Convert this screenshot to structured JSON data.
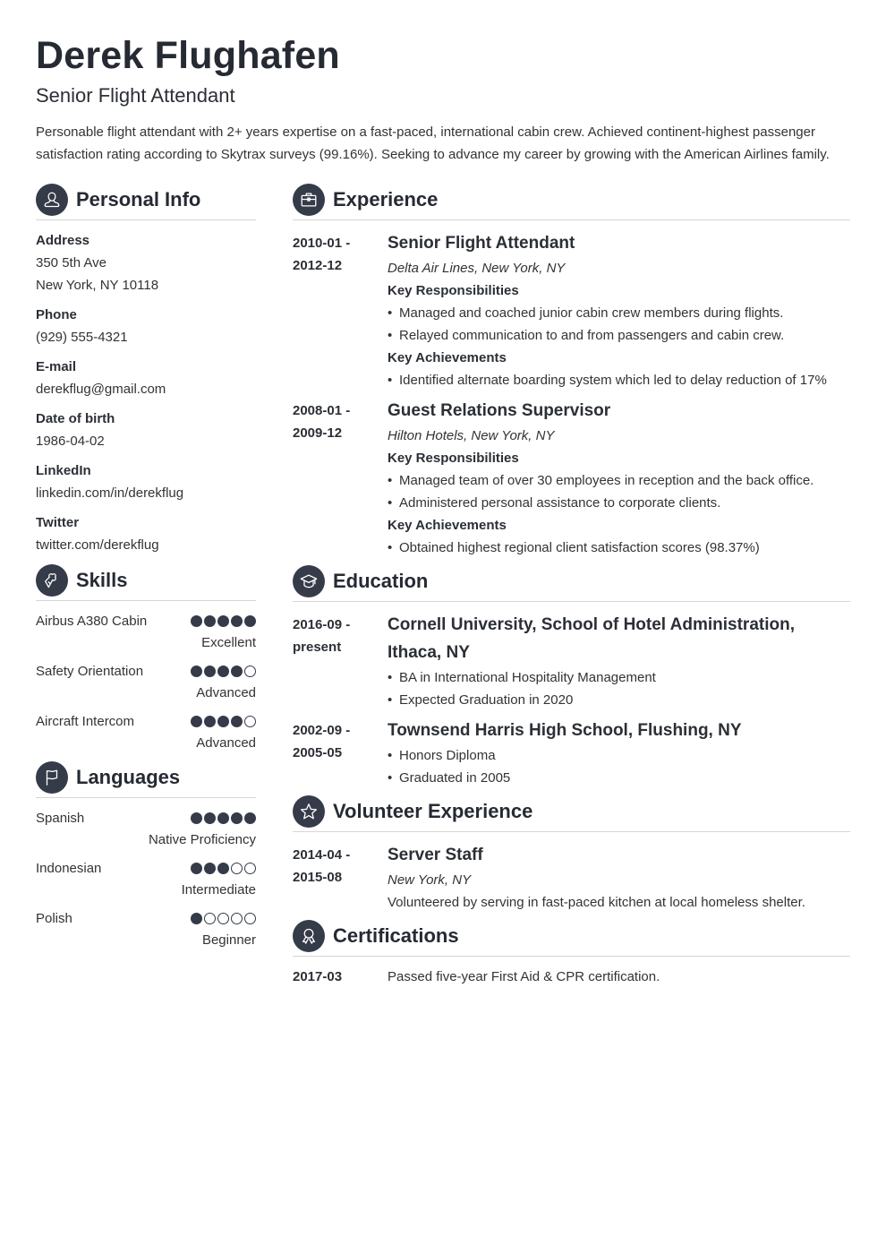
{
  "header": {
    "name": "Derek Flughafen",
    "title": "Senior Flight Attendant",
    "summary": "Personable flight attendant with 2+ years expertise on a fast-paced, international cabin crew. Achieved continent-highest passenger satisfaction rating according to Skytrax surveys (99.16%). Seeking to advance my career by growing with the American Airlines family."
  },
  "personal_info": {
    "heading": "Personal Info",
    "icon": "person-icon",
    "fields": [
      {
        "label": "Address",
        "values": [
          "350 5th Ave",
          "New York, NY 10118"
        ]
      },
      {
        "label": "Phone",
        "values": [
          "(929) 555-4321"
        ]
      },
      {
        "label": "E-mail",
        "values": [
          "derekflug@gmail.com"
        ]
      },
      {
        "label": "Date of birth",
        "values": [
          "1986-04-02"
        ]
      },
      {
        "label": "LinkedIn",
        "values": [
          "linkedin.com/in/derekflug"
        ]
      },
      {
        "label": "Twitter",
        "values": [
          "twitter.com/derekflug"
        ]
      }
    ]
  },
  "skills": {
    "heading": "Skills",
    "icon": "puzzle-icon",
    "items": [
      {
        "name": "Airbus A380 Cabin",
        "rating": 5,
        "max": 5,
        "level": "Excellent"
      },
      {
        "name": "Safety Orientation",
        "rating": 4,
        "max": 5,
        "level": "Advanced"
      },
      {
        "name": "Aircraft Intercom",
        "rating": 4,
        "max": 5,
        "level": "Advanced"
      }
    ]
  },
  "languages": {
    "heading": "Languages",
    "icon": "flag-icon",
    "items": [
      {
        "name": "Spanish",
        "rating": 5,
        "max": 5,
        "level": "Native Proficiency"
      },
      {
        "name": "Indonesian",
        "rating": 3,
        "max": 5,
        "level": "Intermediate"
      },
      {
        "name": "Polish",
        "rating": 1,
        "max": 5,
        "level": "Beginner"
      }
    ]
  },
  "experience": {
    "heading": "Experience",
    "icon": "briefcase-icon",
    "items": [
      {
        "date_start": "2010-01 -",
        "date_end": "2012-12",
        "role": "Senior Flight Attendant",
        "org": "Delta Air Lines, New York, NY",
        "resp_label": "Key Responsibilities",
        "responsibilities": [
          "Managed and coached junior cabin crew members during flights.",
          "Relayed communication to and from passengers and cabin crew."
        ],
        "ach_label": "Key Achievements",
        "achievements": [
          "Identified alternate boarding system which led to delay reduction of 17%"
        ]
      },
      {
        "date_start": "2008-01 -",
        "date_end": "2009-12",
        "role": "Guest Relations Supervisor",
        "org": "Hilton Hotels, New York, NY",
        "resp_label": "Key Responsibilities",
        "responsibilities": [
          "Managed team of over 30 employees in reception and the back office.",
          "Administered personal assistance to corporate clients."
        ],
        "ach_label": "Key Achievements",
        "achievements": [
          "Obtained highest regional client satisfaction scores (98.37%)"
        ]
      }
    ]
  },
  "education": {
    "heading": "Education",
    "icon": "graduation-cap-icon",
    "items": [
      {
        "date_start": "2016-09 -",
        "date_end": "present",
        "school": "Cornell University, School of Hotel Administration, Ithaca, NY",
        "bullets": [
          "BA in International Hospitality Management",
          "Expected Graduation in 2020"
        ]
      },
      {
        "date_start": "2002-09 -",
        "date_end": "2005-05",
        "school": "Townsend Harris High School, Flushing, NY",
        "bullets": [
          "Honors Diploma",
          "Graduated in 2005"
        ]
      }
    ]
  },
  "volunteer": {
    "heading": "Volunteer Experience",
    "icon": "star-icon",
    "items": [
      {
        "date_start": "2014-04 -",
        "date_end": "2015-08",
        "role": "Server Staff",
        "org": "New York, NY",
        "description": "Volunteered by serving in fast-paced kitchen at local homeless shelter."
      }
    ]
  },
  "certifications": {
    "heading": "Certifications",
    "icon": "award-ribbon-icon",
    "items": [
      {
        "date": "2017-03",
        "description": "Passed five-year First Aid & CPR certification."
      }
    ]
  },
  "colors": {
    "accent": "#353b48",
    "text": "#2b2f36",
    "divider": "#d6d6d6"
  }
}
